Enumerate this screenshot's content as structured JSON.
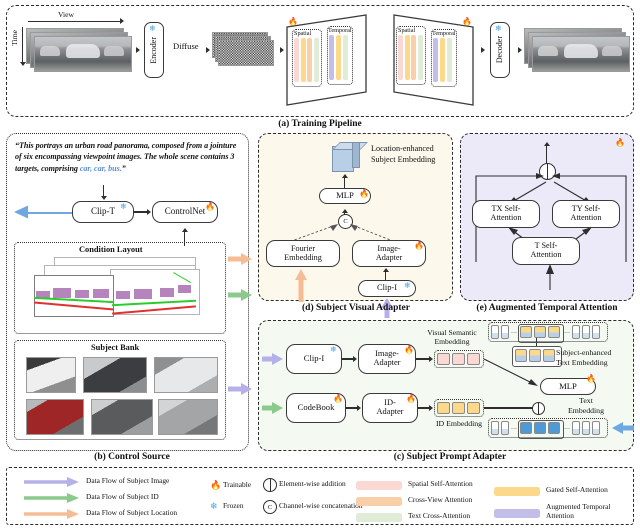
{
  "figure": {
    "panels": [
      {
        "id": "a",
        "caption": "(a) Training Pipeline"
      },
      {
        "id": "b",
        "caption": "(b) Control Source"
      },
      {
        "id": "c",
        "caption": "(c) Subject Prompt Adapter"
      },
      {
        "id": "d",
        "caption": "(d) Subject Visual Adapter"
      },
      {
        "id": "e",
        "caption": "(e) Augmented Temporal Attention"
      }
    ]
  },
  "panel_a": {
    "axis_view": "View",
    "axis_time": "Time",
    "encoder": "Encoder",
    "diffuse": "Diffuse",
    "decoder": "Decoder",
    "unet_left": {
      "spatial": "Spatial",
      "temporal": "Temporal"
    },
    "unet_right": {
      "spatial": "Spatial",
      "temporal": "Temporal"
    }
  },
  "panel_b": {
    "prompt_quote": "“This portrays an urban road panorama, composed from a jointure of six encompassing viewpoint images. The whole scene contains 3 targets, comprising ",
    "prompt_highlight": "car, car, bus.",
    "prompt_quote_end": "”",
    "clip_t": "Clip-T",
    "controlnet": "ControlNet",
    "condition_layout": "Condition Layout",
    "subject_bank": "Subject Bank"
  },
  "panel_c": {
    "clip_i": "Clip-I",
    "image_adapter": "Image-\nAdapter",
    "codebook": "CodeBook",
    "id_adapter": "ID-\nAdapter",
    "mlp": "MLP",
    "visual_semantic_embedding": "Visual Semantic\nEmbedding",
    "id_embedding": "ID Embedding",
    "subject_enhanced_text_embedding": "Subject-enhanced\nText Embedding",
    "text_embedding": "Text\nEmbedding"
  },
  "panel_d": {
    "title_label": "Location-enhanced\nSubject Embedding",
    "mlp": "MLP",
    "fourier_embedding": "Fourier\nEmbedding",
    "image_adapter": "Image-\nAdapter",
    "clip_i": "Clip-I",
    "concat_symbol": "C"
  },
  "panel_e": {
    "tx_self_attention": "TX Self-\nAttention",
    "ty_self_attention": "TY Self-\nAttention",
    "t_self_attention": "T Self-\nAttention"
  },
  "legend": {
    "flows": [
      {
        "label": "Data Flow of Subject Image",
        "color": "#b5b0e8"
      },
      {
        "label": "Data Flow of Subject ID",
        "color": "#8cc98c"
      },
      {
        "label": "Data Flow of Subject Location",
        "color": "#f5bd96"
      }
    ],
    "symbols": [
      {
        "icon": "flame-icon",
        "label": "Trainable",
        "color": "#ef6c1a"
      },
      {
        "icon": "snowflake-icon",
        "label": "Frozen",
        "color": "#4aa3df"
      },
      {
        "icon": "plus-circle-icon",
        "label": "Element-wise addition"
      },
      {
        "icon": "c-circle-icon",
        "label": "Channel-wise concatenation"
      }
    ],
    "swatches": [
      {
        "label": "Spatial Self-Attention",
        "color": "#fad9d5"
      },
      {
        "label": "Cross-View Attention",
        "color": "#f8cfa8"
      },
      {
        "label": "Text Cross-Attention",
        "color": "#e0ebd8"
      },
      {
        "label": "Gated Self-Attention",
        "color": "#fcd98a"
      },
      {
        "label": "Augmented Temporal Attention",
        "color": "#c2bee8"
      }
    ]
  },
  "colors": {
    "spatial": "#fad9d5",
    "cross_view": "#f8cfa8",
    "text_cross": "#e0ebd8",
    "gated": "#fcd98a",
    "temporal": "#c2bee8",
    "panel_d_bg": "#fdf8ec",
    "panel_e_bg": "#eceaf8",
    "panel_c_bg": "#f4faf2",
    "flow_image": "#b5b0e8",
    "flow_id": "#8cc98c",
    "flow_loc": "#f5bd96",
    "text_blue": "#5b8ed6"
  }
}
